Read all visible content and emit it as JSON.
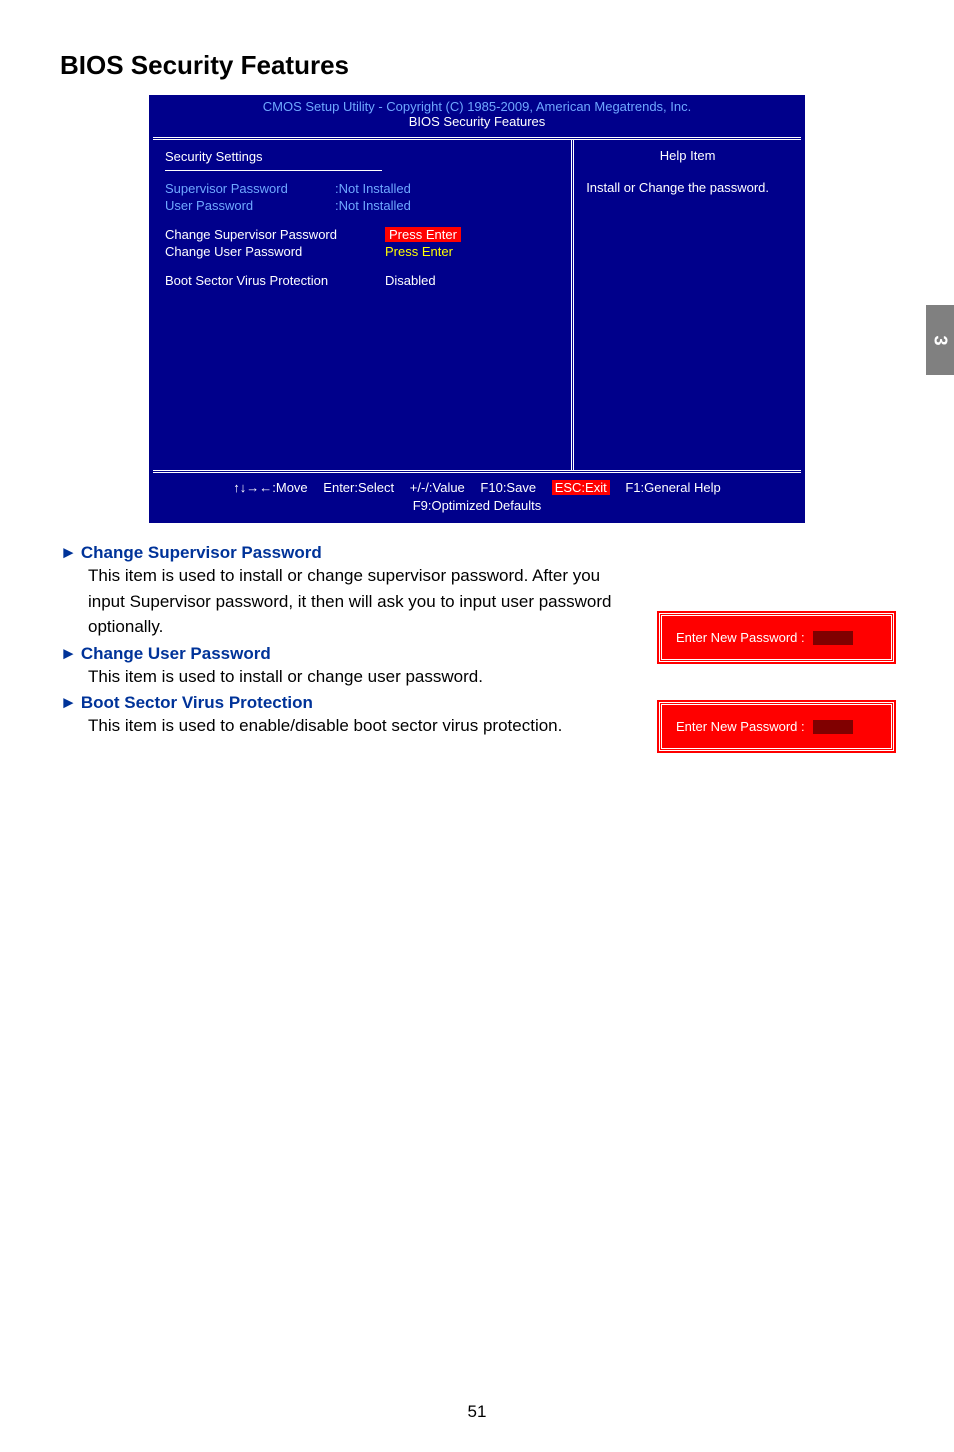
{
  "page": {
    "title": "BIOS Security Features",
    "number": "51",
    "tab": "3"
  },
  "bios": {
    "header_line1": "CMOS Setup Utility - Copyright (C) 1985-2009, American Megatrends, Inc.",
    "header_line2": "BIOS Security Features",
    "section_title": "Security Settings",
    "help_title": "Help Item",
    "help_text": "Install or Change the password.",
    "status": [
      {
        "label": "Supervisor Password",
        "value": ":Not Installed"
      },
      {
        "label": "User Password",
        "value": ":Not Installed"
      }
    ],
    "options": [
      {
        "label": "Change Supervisor Password",
        "value": "Press Enter",
        "style": "highlight"
      },
      {
        "label": "Change User Password",
        "value": "Press Enter",
        "style": "yellow"
      },
      {
        "label": "Boot Sector Virus Protection",
        "value": "Disabled",
        "style": "white"
      }
    ],
    "footer": {
      "move": "↑↓→←:Move",
      "select": "Enter:Select",
      "value": "+/-/:Value",
      "save": "F10:Save",
      "exit": "ESC:Exit",
      "help": "F1:General Help",
      "defaults": "F9:Optimized Defaults"
    }
  },
  "descriptions": [
    {
      "heading": "Change Supervisor Password",
      "text": "This item is used to install or change supervisor password. After you input Supervisor password, it then will ask you to input user password optionally."
    },
    {
      "heading": "Change User Password",
      "text": "This item is used to install or change user password."
    },
    {
      "heading": "Boot Sector Virus Protection",
      "text": "This item is used to enable/disable boot sector virus protection."
    }
  ],
  "password_dialog": {
    "label": "Enter New Password :"
  }
}
